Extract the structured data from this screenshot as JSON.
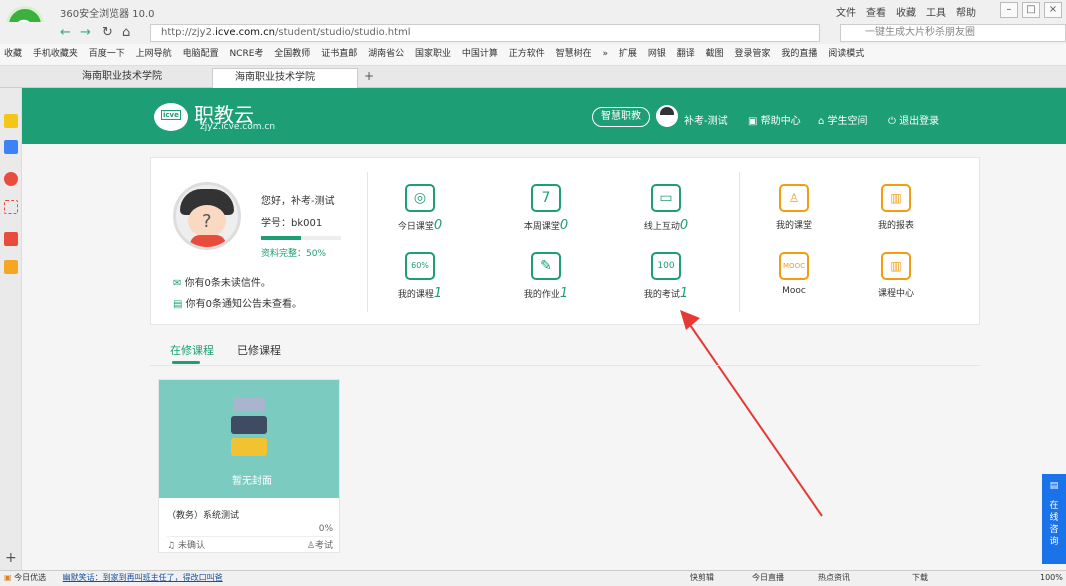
{
  "browser": {
    "title": "360安全浏览器 10.0",
    "menus": [
      "文件",
      "查看",
      "收藏",
      "工具",
      "帮助"
    ],
    "url_prefix": "http://zjy2.",
    "url_domain": "icve.com.cn",
    "url_path": "/student/studio/studio.html",
    "search_text": "一键生成大片秒杀朋友圈",
    "bookmarks": [
      "收藏",
      "手机收藏夹",
      "百度一下",
      "上网导航",
      "电脑配置",
      "NCRE考",
      "全国教师",
      "证书直邮",
      "湖南省公",
      "国家职业",
      "中国计算",
      "正方软件",
      "智慧树在",
      "»",
      "扩展",
      "网银",
      "翻译",
      "截图",
      "登录管家",
      "我的直播",
      "阅读模式"
    ],
    "tabs": [
      "海南职业技术学院",
      "海南职业技术学院"
    ]
  },
  "site": {
    "brand_name": "职教云",
    "brand_url": "zjy2.icve.com.cn",
    "logo_text": "icve",
    "smart_btn": "智慧职教",
    "user_name": "补考-测试",
    "nav": [
      "帮助中心",
      "学生空间",
      "退出登录"
    ]
  },
  "profile": {
    "greeting": "您好，补考-测试",
    "student_no": "学号：bk001",
    "completeness": "资料完整：50%",
    "completeness_value": 0.5,
    "mail": "你有0条未读信件。",
    "notice": "你有0条通知公告未查看。"
  },
  "grid": [
    {
      "label": "今日课堂",
      "count": "0",
      "icon": "ring-icon"
    },
    {
      "label": "本周课堂",
      "count": "0",
      "icon": "calendar-7-icon"
    },
    {
      "label": "线上互动",
      "count": "0",
      "icon": "chat-icon"
    },
    {
      "label": "我的课程",
      "count": "1",
      "icon": "progress-60-icon"
    },
    {
      "label": "我的作业",
      "count": "1",
      "icon": "pencil-paper-icon"
    },
    {
      "label": "我的考试",
      "count": "1",
      "icon": "score-100-icon"
    },
    {
      "label": "我的课堂",
      "count": "",
      "icon": "person-icon"
    },
    {
      "label": "我的报表",
      "count": "",
      "icon": "bar-chart-icon"
    },
    {
      "label": "Mooc",
      "count": "",
      "icon": "mooc-icon"
    },
    {
      "label": "课程中心",
      "count": "",
      "icon": "books-icon"
    }
  ],
  "course_tabs": {
    "current": "在修课程",
    "done": "已修课程"
  },
  "course_card": {
    "cover_text": "暂无封面",
    "name": "（教务）系统测试",
    "percent": "0%",
    "status": "未确认",
    "exam": "考试"
  },
  "consult": "在线咨询",
  "statusbar": {
    "left": "今日优选",
    "news": "幽默笑话：到家到再叫班主任了，得改口叫爸",
    "right": [
      "快剪辑",
      "今日直播",
      "热点资讯",
      "下载"
    ],
    "zoom": "100%"
  },
  "colors": {
    "brand": "#1e9e74",
    "accent_orange": "#f39c12",
    "consult_blue": "#1a73e8"
  }
}
